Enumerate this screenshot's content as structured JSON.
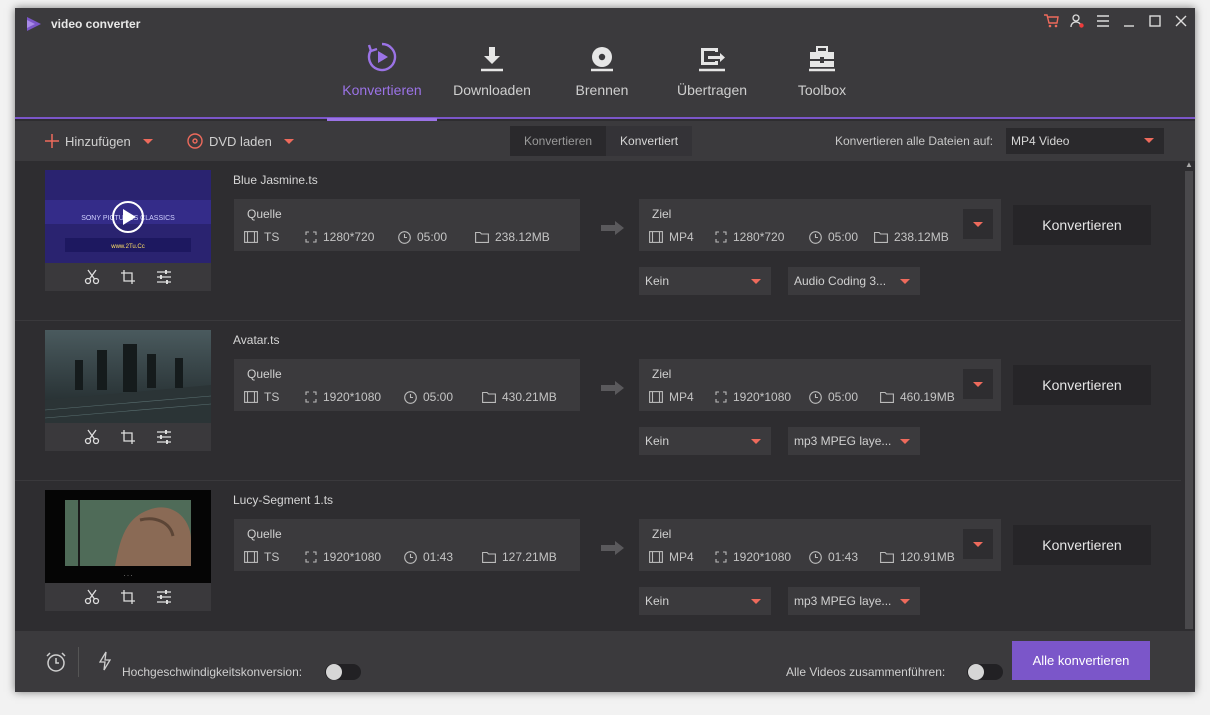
{
  "app": {
    "title": "video converter"
  },
  "nav": [
    {
      "label": "Konvertieren",
      "icon": "convert-icon",
      "active": true
    },
    {
      "label": "Downloaden",
      "icon": "download-icon",
      "active": false
    },
    {
      "label": "Brennen",
      "icon": "disc-icon",
      "active": false
    },
    {
      "label": "Übertragen",
      "icon": "transfer-icon",
      "active": false
    },
    {
      "label": "Toolbox",
      "icon": "toolbox-icon",
      "active": false
    }
  ],
  "toolbar": {
    "add_label": "Hinzufügen",
    "dvd_label": "DVD laden",
    "seg_converting": "Konvertieren",
    "seg_converted": "Konvertiert",
    "output_label": "Konvertieren alle Dateien auf:",
    "output_value": "MP4 Video"
  },
  "files": [
    {
      "name": "Blue Jasmine.ts",
      "thumb_caption": "SONY PICTURES CLASSICS",
      "source": {
        "title": "Quelle",
        "format": "TS",
        "resolution": "1280*720",
        "duration": "05:00",
        "size": "238.12MB"
      },
      "target": {
        "title": "Ziel",
        "format": "MP4",
        "resolution": "1280*720",
        "duration": "05:00",
        "size": "238.12MB"
      },
      "subtitle": "Kein",
      "audio": "Audio Coding 3...",
      "button": "Konvertieren"
    },
    {
      "name": "Avatar.ts",
      "source": {
        "title": "Quelle",
        "format": "TS",
        "resolution": "1920*1080",
        "duration": "05:00",
        "size": "430.21MB"
      },
      "target": {
        "title": "Ziel",
        "format": "MP4",
        "resolution": "1920*1080",
        "duration": "05:00",
        "size": "460.19MB"
      },
      "subtitle": "Kein",
      "audio": "mp3 MPEG laye...",
      "button": "Konvertieren"
    },
    {
      "name": "Lucy-Segment 1.ts",
      "source": {
        "title": "Quelle",
        "format": "TS",
        "resolution": "1920*1080",
        "duration": "01:43",
        "size": "127.21MB"
      },
      "target": {
        "title": "Ziel",
        "format": "MP4",
        "resolution": "1920*1080",
        "duration": "01:43",
        "size": "120.91MB"
      },
      "subtitle": "Kein",
      "audio": "mp3 MPEG laye...",
      "button": "Konvertieren"
    }
  ],
  "footer": {
    "highspeed_label": "Hochgeschwindigkeitskonversion:",
    "merge_label": "Alle Videos zusammenführen:",
    "convert_all": "Alle konvertieren"
  },
  "colors": {
    "accent": "#7b56c9",
    "accent_text": "#9b73e6",
    "caret": "#ee6a5c"
  }
}
